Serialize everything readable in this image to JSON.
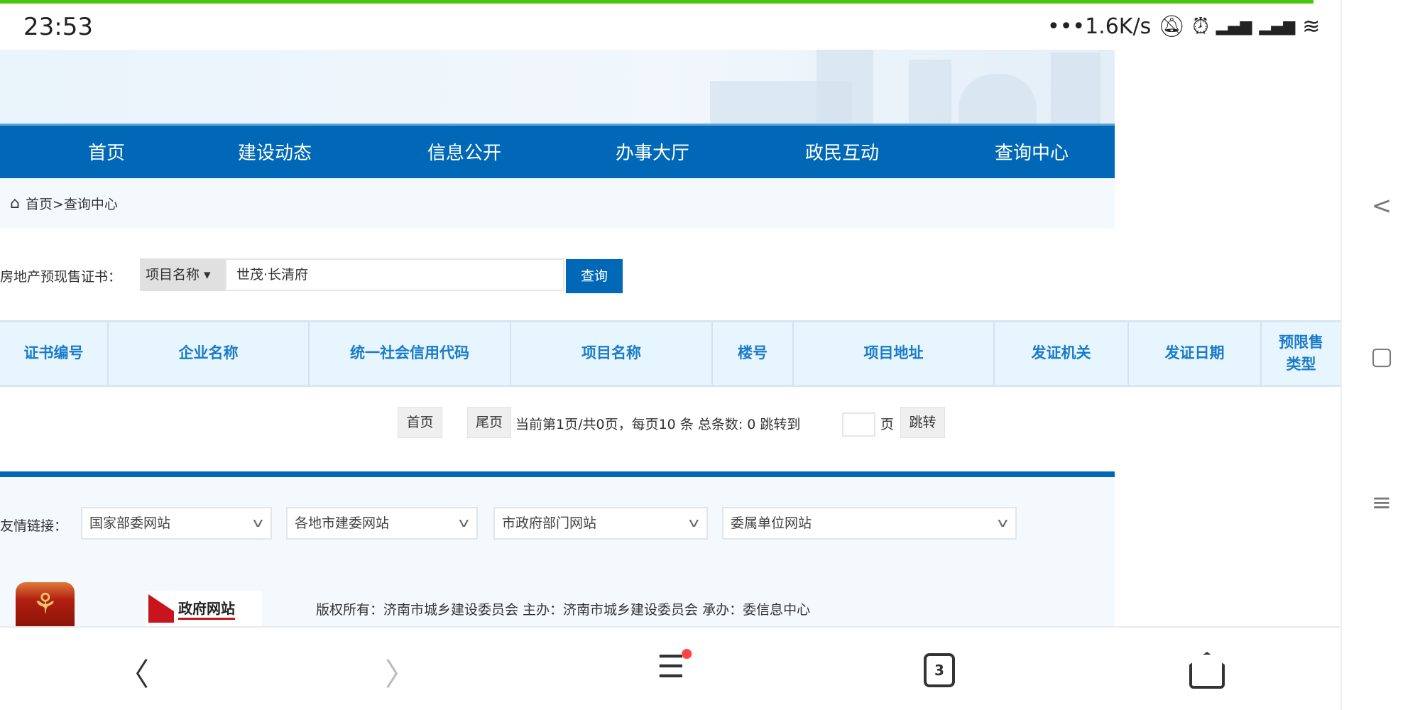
{
  "status_bar": {
    "time": "23:53",
    "net_speed": "•••1.6K/s",
    "icons": [
      "mute-icon",
      "alarm-icon",
      "signal-icon",
      "signal-icon",
      "wifi-icon"
    ]
  },
  "nav": {
    "items": [
      "首页",
      "建设动态",
      "信息公开",
      "办事大厅",
      "政民互动",
      "查询中心"
    ]
  },
  "breadcrumb": {
    "text": "首页>查询中心"
  },
  "search": {
    "label": "房地产预现售证书：",
    "select_value": "项目名称 ▾",
    "input_value": "世茂·长清府",
    "button": "查询"
  },
  "table": {
    "headers": [
      "证书编号",
      "企业名称",
      "统一社会信用代码",
      "项目名称",
      "楼号",
      "项目地址",
      "发证机关",
      "发证日期",
      "预限售类型"
    ]
  },
  "pager": {
    "first": "首页",
    "last": "尾页",
    "info": "当前第1页/共0页，每页10 条 总条数: 0 跳转到",
    "page_unit": "页",
    "go": "跳转",
    "jump_value": ""
  },
  "footer": {
    "links_label": "友情链接：",
    "selects": [
      "国家部委网站",
      "各地市建委网站",
      "市政府部门网站",
      "委属单位网站"
    ],
    "gov_logo": "政府网站",
    "copyright": "版权所有：济南市城乡建设委员会 主办：济南市城乡建设委员会 承办：委信息中心"
  },
  "bottom_nav": {
    "tab_count": "3"
  },
  "colors": {
    "brand": "#0068b7",
    "header_text": "#1a7bc9",
    "top_bar": "#4cc412"
  }
}
